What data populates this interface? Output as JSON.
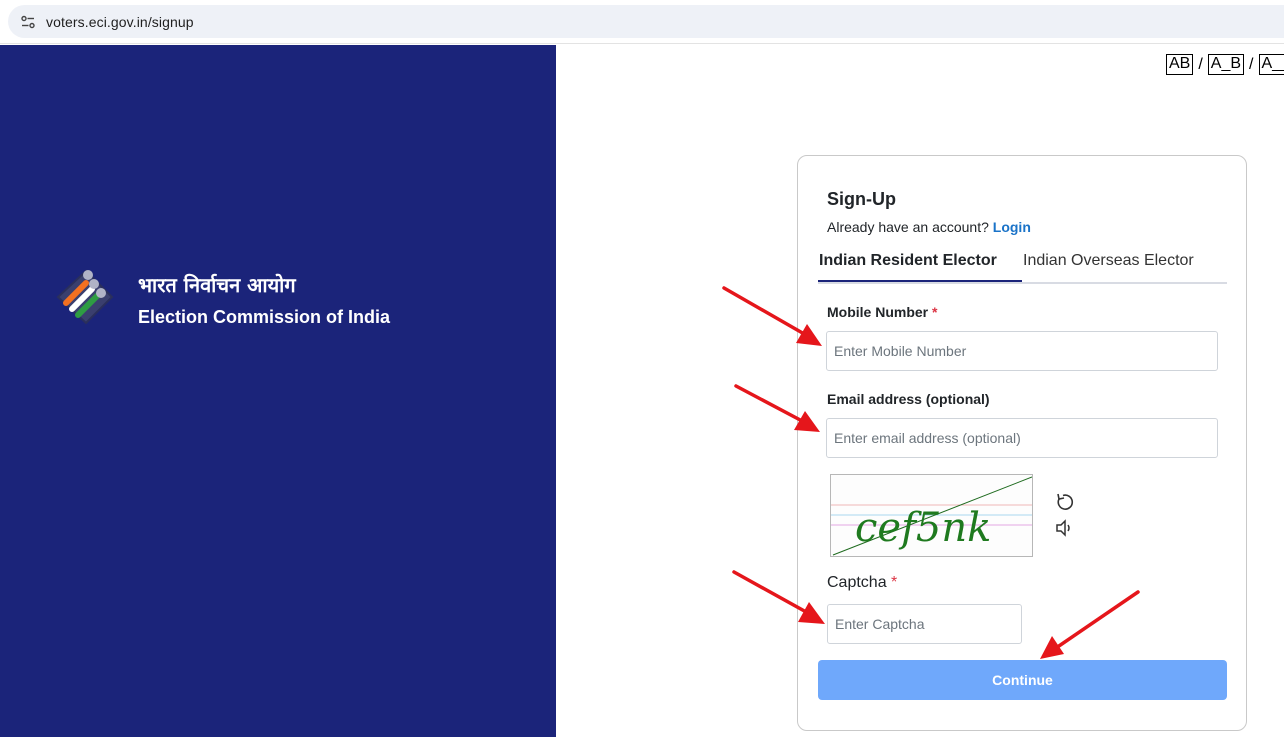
{
  "browser": {
    "url": "voters.eci.gov.in/signup"
  },
  "brand": {
    "name_hindi": "भारत निर्वाचन आयोग",
    "name_english": "Election Commission of India"
  },
  "font_switcher": {
    "options": [
      "AB",
      "A_B",
      "A__B"
    ],
    "separator": "/"
  },
  "signup": {
    "title": "Sign-Up",
    "already_text": "Already have an account?",
    "login_label": "Login",
    "tabs": [
      {
        "label": "Indian Resident Elector",
        "active": true
      },
      {
        "label": "Indian Overseas Elector",
        "active": false
      }
    ],
    "mobile": {
      "label": "Mobile Number",
      "required_mark": "*",
      "placeholder": "Enter Mobile Number"
    },
    "email": {
      "label": "Email address (optional)",
      "placeholder": "Enter email address (optional)"
    },
    "captcha": {
      "image_text": "cef5nk",
      "label": "Captcha",
      "required_mark": "*",
      "placeholder": "Enter Captcha"
    },
    "continue_label": "Continue"
  },
  "colors": {
    "brand_panel": "#1b247a",
    "continue_button": "#6fa8fb",
    "link": "#1a73c8",
    "required": "#dc3545",
    "annotation_arrow": "#e5161b"
  }
}
